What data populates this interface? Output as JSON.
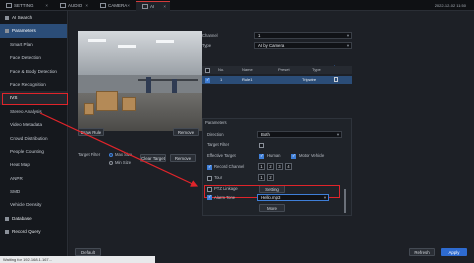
{
  "tabs": [
    {
      "label": "SETTING"
    },
    {
      "label": "AUDIO"
    },
    {
      "label": "CAMERA"
    },
    {
      "label": "AI"
    }
  ],
  "topbar": {
    "datetime": "2022-12-02 11:50"
  },
  "sidebar": {
    "items": [
      {
        "label": "AI Search",
        "type": "group"
      },
      {
        "label": "Parameters",
        "type": "group-active"
      },
      {
        "label": "Smart Plan",
        "type": "item"
      },
      {
        "label": "Face Detection",
        "type": "item"
      },
      {
        "label": "Face & Body Detection",
        "type": "item"
      },
      {
        "label": "Face Recognition",
        "type": "item"
      },
      {
        "label": "IVS",
        "type": "selected"
      },
      {
        "label": "Stereo Analysis",
        "type": "item"
      },
      {
        "label": "Video Metadata",
        "type": "item"
      },
      {
        "label": "Crowd Distribution",
        "type": "item"
      },
      {
        "label": "People Counting",
        "type": "item"
      },
      {
        "label": "Heat Map",
        "type": "item"
      },
      {
        "label": "ANPR",
        "type": "item"
      },
      {
        "label": "SMD",
        "type": "item"
      },
      {
        "label": "Vehicle Density",
        "type": "item"
      },
      {
        "label": "Database",
        "type": "group"
      },
      {
        "label": "Record Query",
        "type": "group"
      }
    ]
  },
  "main": {
    "channel_label": "Channel",
    "channel_value": "1",
    "type_label": "Type",
    "type_value": "AI by Camera",
    "columns": [
      "No.",
      "Name",
      "Preset",
      "Type"
    ],
    "rows": [
      {
        "no": "1",
        "name": "Rule1",
        "preset": "",
        "type": "Tripwire"
      }
    ],
    "draw_rule_btn": "Draw Rule",
    "remove_btn": "Remove",
    "target_filter_label": "Target Filter",
    "max_size_label": "Max Size",
    "min_size_label": "Min Size",
    "clear_target_btn": "Clear Target",
    "remove_btn2": "Remove",
    "parameters_label": "Parameters",
    "direction_label": "Direction",
    "direction_value": "Both",
    "target_filter2_label": "Target Filter",
    "effective_target_label": "Effective Target",
    "human_label": "Human",
    "motor_label": "Motor Vehicle",
    "record_channel_label": "Record Channel",
    "channels": [
      "1",
      "2",
      "3",
      "4"
    ],
    "tour_label": "Tour",
    "ptz_label": "PTZ Linkage",
    "setting_btn": "Setting",
    "alarm_tone_label": "Alarm Tone",
    "alarm_tone_value": "Hello.mp3",
    "more_btn": "More",
    "default_btn": "Default",
    "refresh_btn": "Refresh",
    "apply_btn": "Apply"
  },
  "status": "Waiting for 192.168.1.167...",
  "colors": {
    "accent": "#3f7fd8",
    "highlight": "#e0242a"
  }
}
